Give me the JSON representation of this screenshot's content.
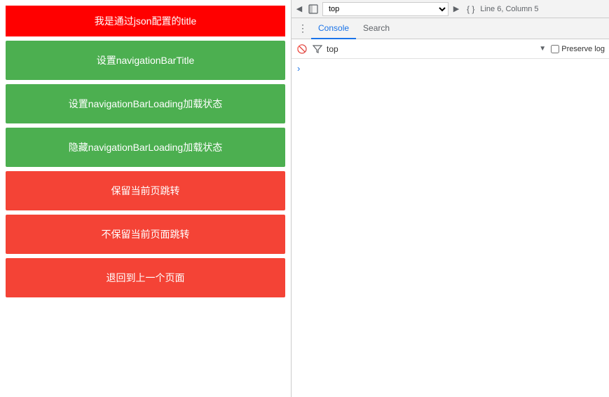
{
  "leftPanel": {
    "titleBar": "我是通过json配置的title",
    "greenButtons": [
      "设置navigationBarTitle",
      "设置navigationBarLoading加载状态",
      "隐藏navigationBarLoading加载状态"
    ],
    "redButtons": [
      "保留当前页跳转",
      "不保留当前页面跳转",
      "退回到上一个页面"
    ]
  },
  "devtools": {
    "lineInfo": "Line 6, Column 5",
    "tabs": [
      {
        "label": "Console",
        "active": true
      },
      {
        "label": "Search",
        "active": false
      }
    ],
    "filter": {
      "placeholder": "top",
      "value": "top"
    },
    "preserveLog": "Preserve log",
    "consoleCaret": "›"
  }
}
